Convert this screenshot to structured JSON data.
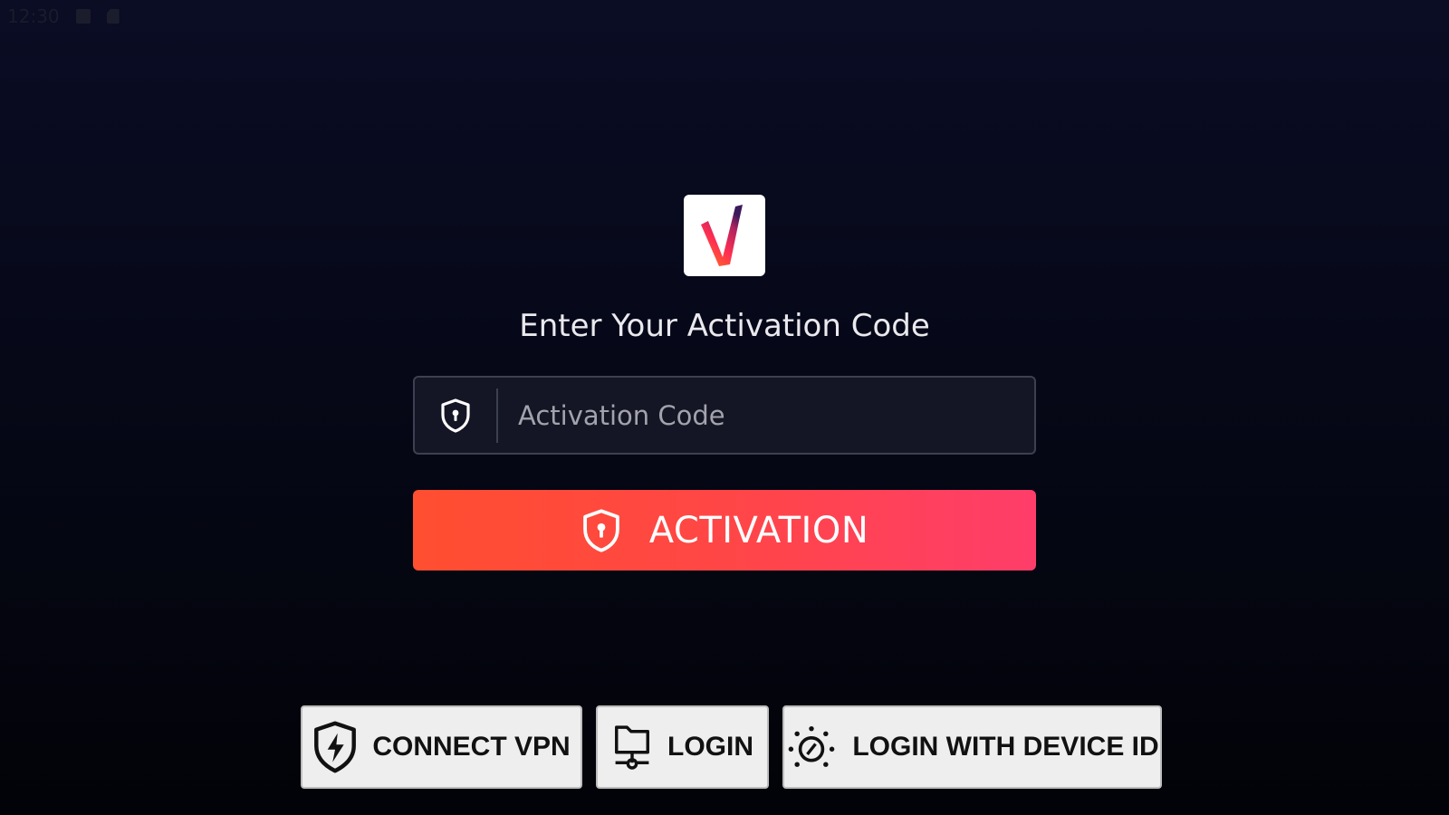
{
  "status_bar": {
    "time": "12:30",
    "icons": [
      "image-icon",
      "sd-card-icon"
    ]
  },
  "logo": {
    "letter": "V",
    "colors": [
      "#ff5a1f",
      "#e0245e",
      "#3b1a5c"
    ]
  },
  "heading": "Enter Your Activation Code",
  "activation_input": {
    "placeholder": "Activation Code",
    "value": "",
    "icon": "shield-lock-icon"
  },
  "activation_button": {
    "label": "ACTIVATION",
    "icon": "shield-lock-icon",
    "colors": [
      "#ff4e30",
      "#ff3d6a"
    ]
  },
  "bottom_buttons": [
    {
      "label": "CONNECT VPN",
      "icon": "shield-bolt-icon"
    },
    {
      "label": "LOGIN",
      "icon": "network-folder-icon"
    },
    {
      "label": "LOGIN WITH DEVICE ID",
      "icon": "device-scan-icon"
    }
  ]
}
